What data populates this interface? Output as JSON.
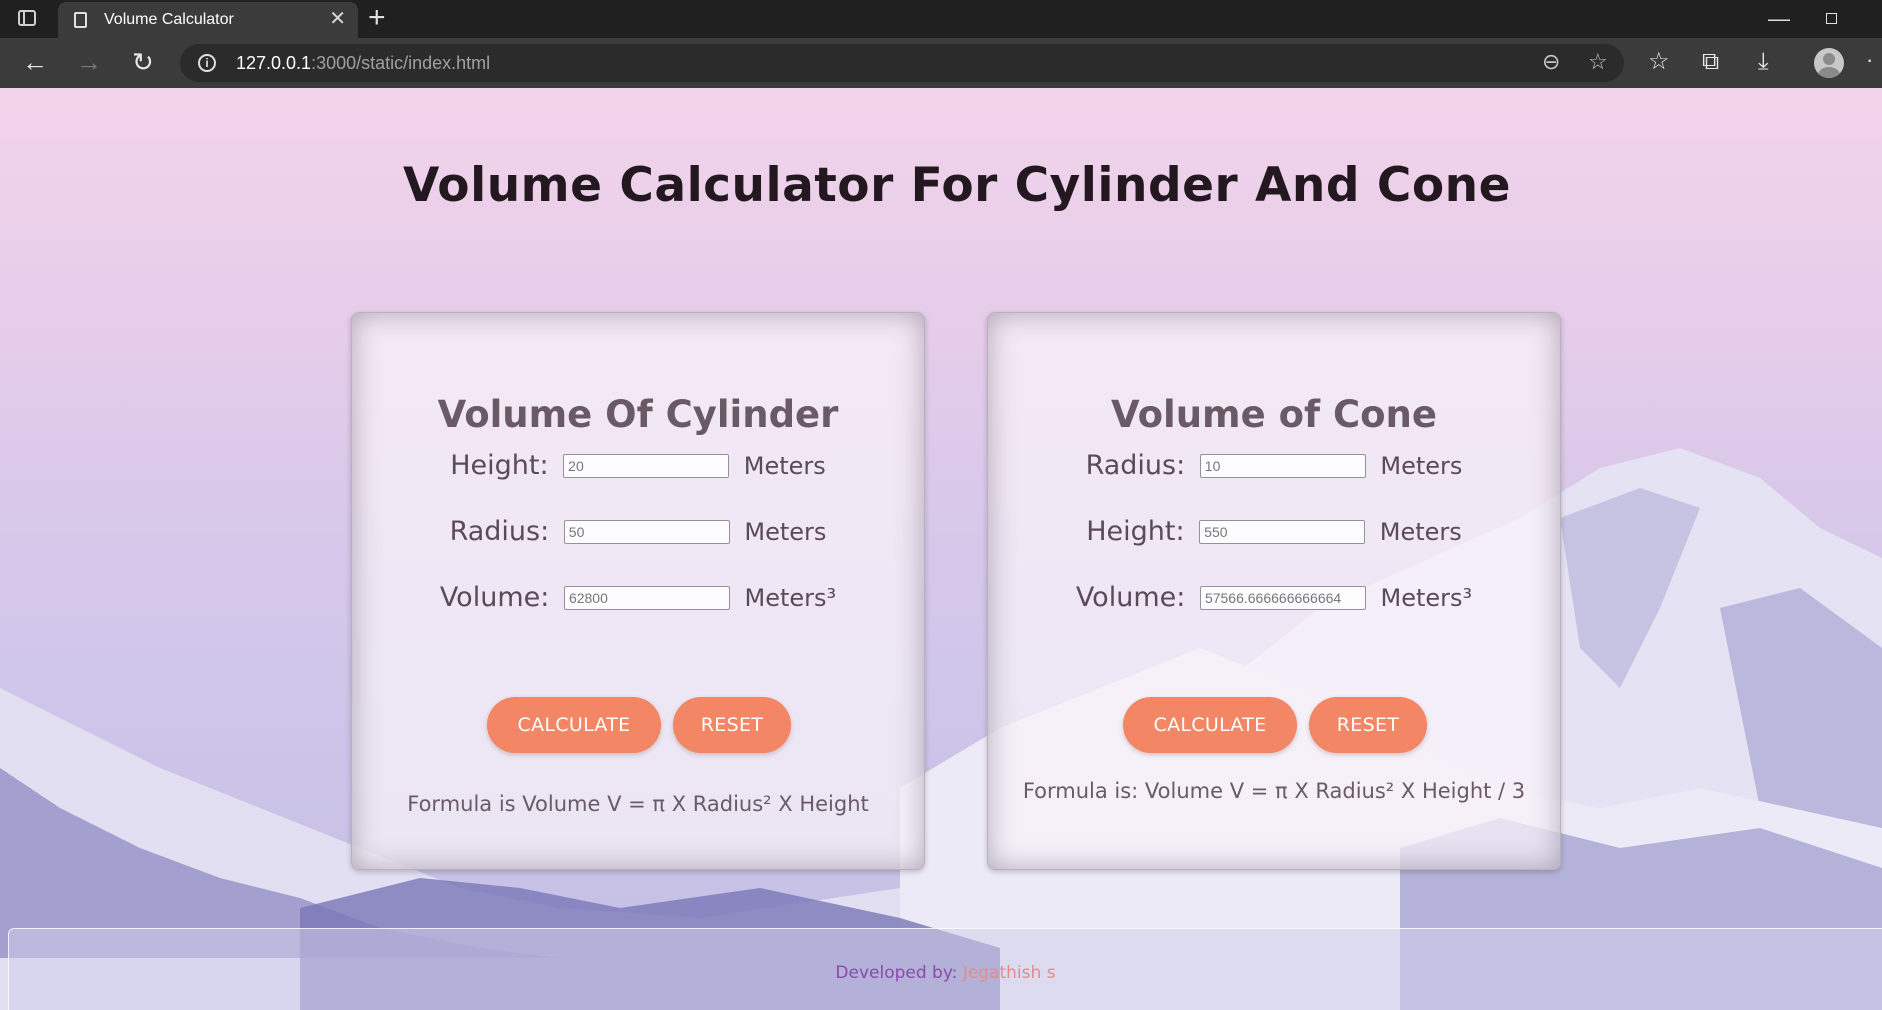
{
  "browser": {
    "tab_title": "Volume Calculator",
    "url_host": "127.0.0.1",
    "url_rest": ":3000/static/index.html"
  },
  "page": {
    "title": "Volume Calculator For Cylinder And Cone"
  },
  "cylinder": {
    "title": "Volume Of Cylinder",
    "height_label": "Height:",
    "height_value": "20",
    "radius_label": "Radius:",
    "radius_value": "50",
    "volume_label": "Volume:",
    "volume_value": "62800",
    "unit": "Meters",
    "volume_unit": "Meters³",
    "calculate_label": "CALCULATE",
    "reset_label": "RESET",
    "formula": "Formula is Volume V = π X Radius² X Height"
  },
  "cone": {
    "title": "Volume of Cone",
    "radius_label": "Radius:",
    "radius_value": "10",
    "height_label": "Height:",
    "height_value": "550",
    "volume_label": "Volume:",
    "volume_value": "57566.666666666664",
    "unit": "Meters",
    "volume_unit": "Meters³",
    "calculate_label": "CALCULATE",
    "reset_label": "RESET",
    "formula": "Formula is: Volume V = π X Radius² X Height / 3"
  },
  "footer": {
    "prefix": "Developed by:",
    "developer": "Jegathish s"
  },
  "colors": {
    "button": "#f28665",
    "title": "#231820"
  }
}
